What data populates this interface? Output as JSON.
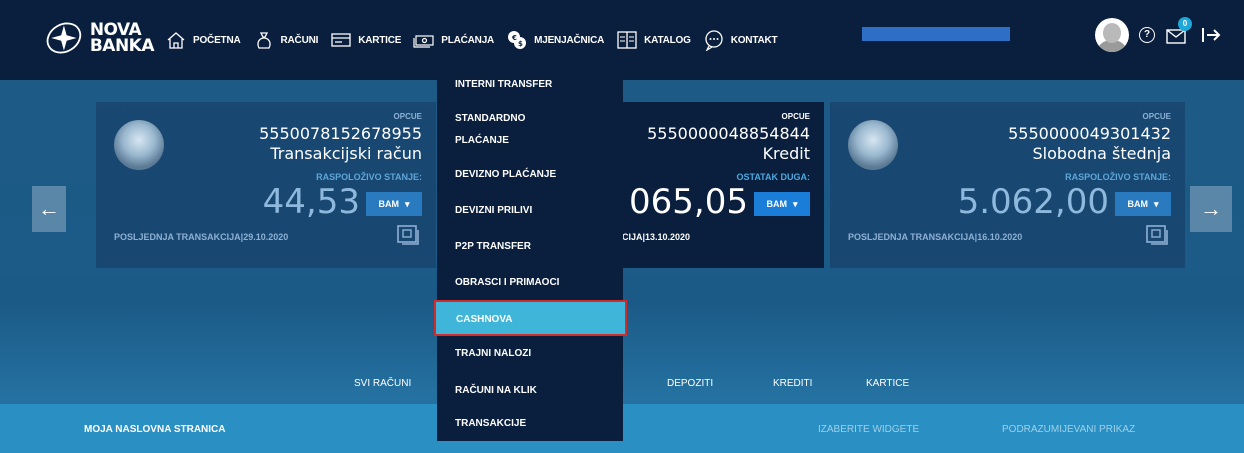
{
  "logo": {
    "line1": "NOVA",
    "line2": "BANKA"
  },
  "nav": [
    {
      "label": "POČETNA",
      "icon": "home-icon"
    },
    {
      "label": "RAČUNI",
      "icon": "money-bag-icon"
    },
    {
      "label": "KARTICE",
      "icon": "card-icon"
    },
    {
      "label": "PLAĆANJA",
      "icon": "cash-icon"
    },
    {
      "label": "MJENJAČNICA",
      "icon": "exchange-icon"
    },
    {
      "label": "KATALOG",
      "icon": "catalog-icon"
    },
    {
      "label": "KONTAKT",
      "icon": "chat-icon"
    }
  ],
  "header": {
    "help": "?",
    "mail_badge": "0"
  },
  "cards": [
    {
      "tag": "OPCUE",
      "account": "5550078152678955",
      "type": "Transakcijski račun",
      "balance_label": "RASPOLOŽIVO STANJE:",
      "amount": "44,53",
      "currency": "BAM",
      "last": "POSLJEDNJA TRANSAKCIJA|29.10.2020"
    },
    {
      "tag": "OPCUE",
      "account": "5550000048854844",
      "type": "Kredit",
      "balance_label": "OSTATAK DUGA:",
      "amount": "065,05",
      "currency": "BAM",
      "last": "CIJA|13.10.2020"
    },
    {
      "tag": "OPCUE",
      "account": "5550000049301432",
      "type": "Slobodna štednja",
      "balance_label": "RASPOLOŽIVO STANJE:",
      "amount": "5.062,00",
      "currency": "BAM",
      "last": "POSLJEDNJA TRANSAKCIJA|16.10.2020"
    }
  ],
  "subnav": {
    "all": "SVI RAČUNI",
    "deposits": "DEPOZITI",
    "credits": "KREDITI",
    "cards": "KARTICE"
  },
  "bottom": {
    "title": "MOJA NASLOVNA STRANICA",
    "widgets": "IZABERITE WIDGETE",
    "default_view": "PODRAZUMIJEVANI PRIKAZ"
  },
  "dropdown": {
    "items": [
      "INTERNI TRANSFER",
      "STANDARDNO",
      "PLAĆANJE",
      "DEVIZNO PLAĆANJE",
      "DEVIZNI PRILIVI",
      "P2P TRANSFER",
      "OBRASCI I PRIMAOCI",
      "CASHNOVA",
      "TRAJNI NALOZI",
      "RAČUNI NA KLIK",
      "TRANSAKCIJE"
    ],
    "selected": "CASHNOVA"
  },
  "colors": {
    "highlight": "#3fb6d9",
    "highlight_border": "#d12b2b"
  }
}
